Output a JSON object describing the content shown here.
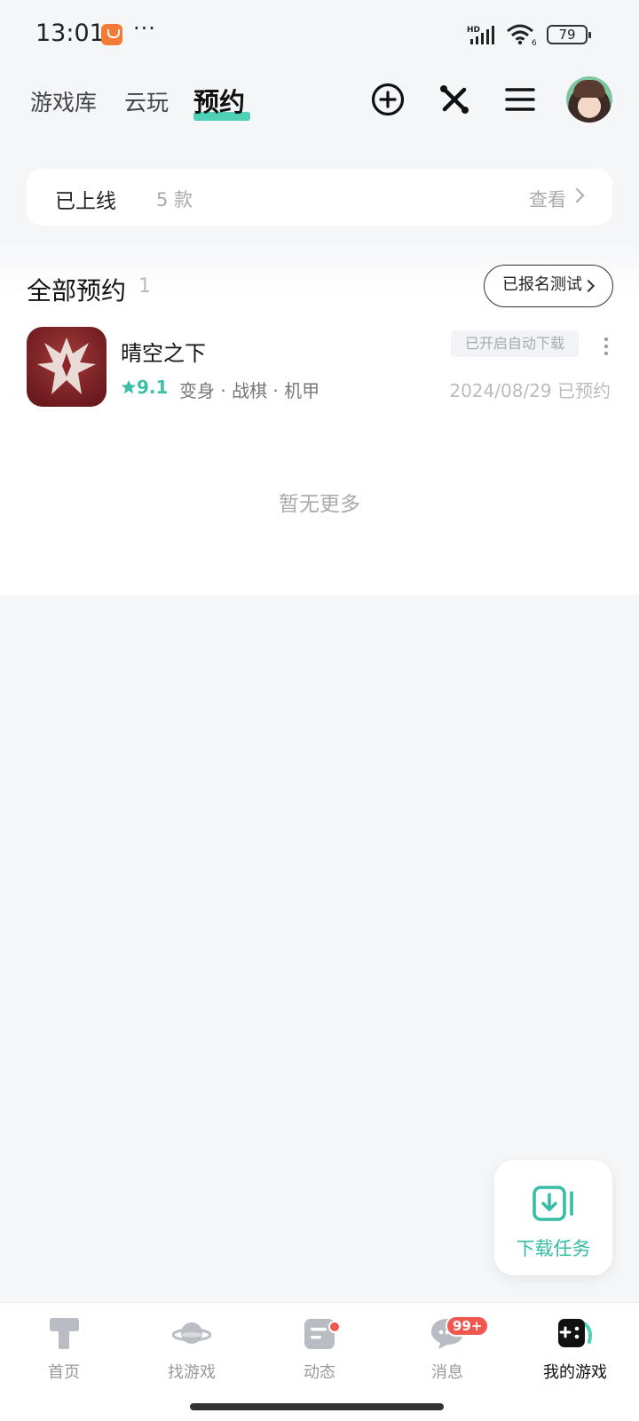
{
  "status_bar": {
    "time": "13:01",
    "dots": "···",
    "network_label": "HD",
    "wifi_sub": "6",
    "battery": "79"
  },
  "top_nav": {
    "tabs": [
      {
        "label": "游戏库"
      },
      {
        "label": "云玩"
      },
      {
        "label": "预约",
        "active": true
      }
    ],
    "icons": [
      "add-circle-icon",
      "tools-icon",
      "menu-icon",
      "avatar"
    ]
  },
  "online": {
    "title": "已上线",
    "count": "5 款",
    "view_label": "查看"
  },
  "reservations": {
    "title": "全部预约",
    "count": "1",
    "signup_label": "已报名测试",
    "items": [
      {
        "name": "晴空之下",
        "rating": "9.1",
        "tags": "变身 · 战棋 · 机甲",
        "auto_download": "已开启自动下载",
        "date_status": "2024/08/29 已预约"
      }
    ],
    "no_more": "暂无更多"
  },
  "download_fab": {
    "label": "下载任务"
  },
  "bottom_nav": {
    "items": [
      {
        "label": "首页",
        "icon": "home-icon"
      },
      {
        "label": "找游戏",
        "icon": "planet-icon"
      },
      {
        "label": "动态",
        "icon": "feed-icon"
      },
      {
        "label": "消息",
        "icon": "chat-icon",
        "badge": "99+"
      },
      {
        "label": "我的游戏",
        "icon": "gamepad-icon",
        "active": true
      }
    ]
  },
  "colors": {
    "accent": "#4fd1b8",
    "accent_text": "#35bca5",
    "badge_red": "#f0574f",
    "background": "#f5f6f8"
  }
}
